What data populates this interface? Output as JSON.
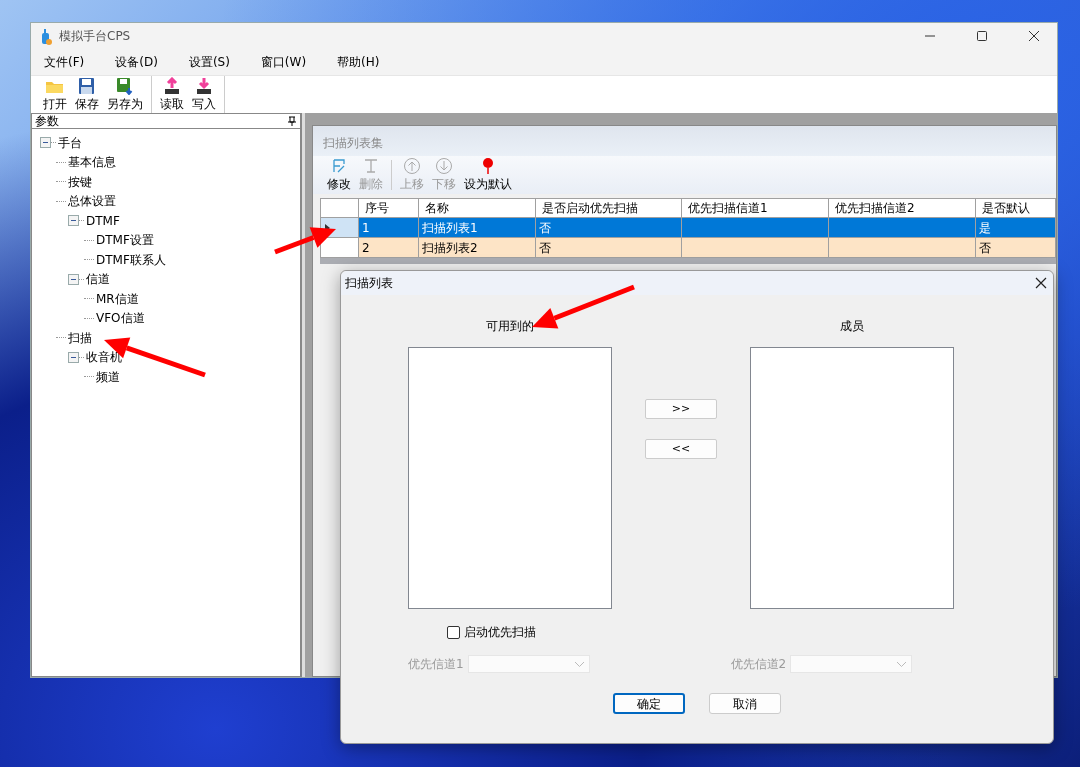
{
  "window": {
    "title": "模拟手台CPS"
  },
  "menu": [
    "文件(F)",
    "设备(D)",
    "设置(S)",
    "窗口(W)",
    "帮助(H)"
  ],
  "toolbar_groups": [
    [
      "打开",
      "保存",
      "另存为"
    ],
    [
      "读取",
      "写入"
    ]
  ],
  "panel": {
    "title": "参数",
    "tree": [
      {
        "label": "手台",
        "expanded": true,
        "children": [
          {
            "label": "基本信息"
          },
          {
            "label": "按键"
          },
          {
            "label": "总体设置"
          },
          {
            "label": "DTMF",
            "expanded": true,
            "children": [
              {
                "label": "DTMF设置"
              },
              {
                "label": "DTMF联系人"
              }
            ]
          },
          {
            "label": "信道",
            "expanded": true,
            "children": [
              {
                "label": "MR信道"
              },
              {
                "label": "VFO信道"
              }
            ]
          },
          {
            "label": "扫描"
          },
          {
            "label": "收音机",
            "expanded": true,
            "children": [
              {
                "label": "频道"
              }
            ]
          }
        ]
      }
    ]
  },
  "child_window": {
    "title": "扫描列表集",
    "toolbar": [
      {
        "label": "修改",
        "disabled": false
      },
      {
        "label": "删除",
        "disabled": true
      },
      {
        "label": "上移",
        "disabled": true
      },
      {
        "label": "下移",
        "disabled": true
      },
      {
        "label": "设为默认",
        "disabled": false
      }
    ],
    "table": {
      "columns": [
        "序号",
        "名称",
        "是否启动优先扫描",
        "优先扫描信道1",
        "优先扫描信道2",
        "是否默认"
      ],
      "rows": [
        {
          "selected": true,
          "cells": [
            "1",
            "扫描列表1",
            "否",
            null,
            null,
            "是"
          ]
        },
        {
          "selected": false,
          "cells": [
            "2",
            "扫描列表2",
            "否",
            null,
            null,
            "否"
          ]
        }
      ]
    }
  },
  "dialog": {
    "title": "扫描列表",
    "available_label": "可用到的",
    "members_label": "成员",
    "move_buttons": [
      ">>",
      "<<"
    ],
    "checkbox": {
      "label": "启动优先扫描",
      "checked": false
    },
    "combos": [
      {
        "label": "优先信道1",
        "disabled": true
      },
      {
        "label": "优先信道2",
        "disabled": true
      }
    ],
    "buttons": [
      {
        "label": "确定",
        "default": true
      },
      {
        "label": "取消",
        "default": false
      }
    ]
  }
}
